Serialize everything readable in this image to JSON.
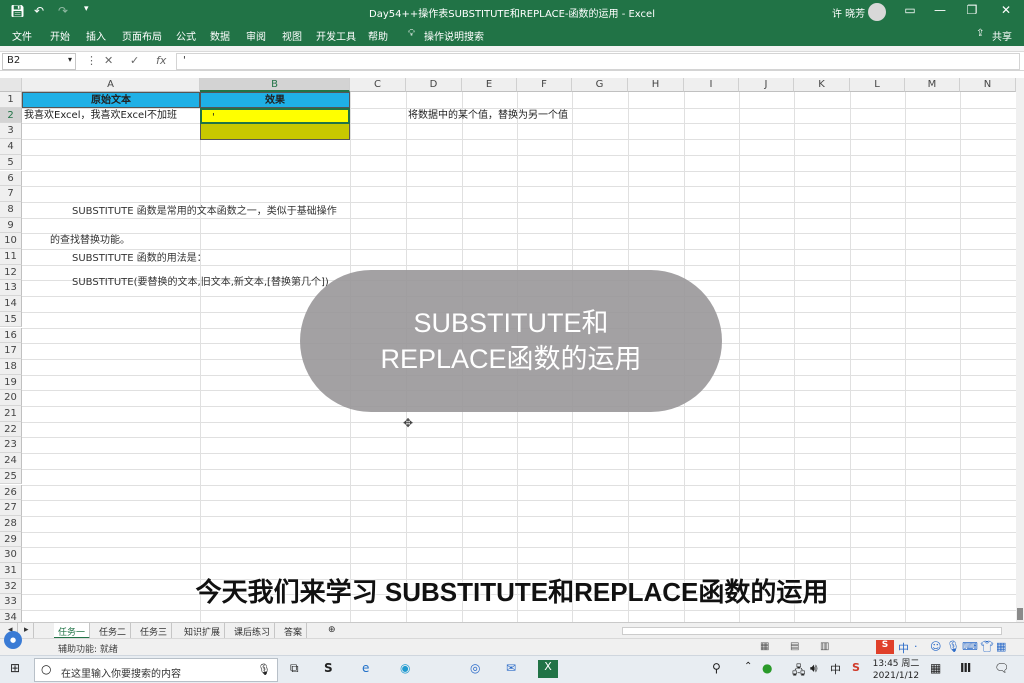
{
  "window": {
    "title": "Day54++操作表SUBSTITUTE和REPLACE-函数的运用 - Excel",
    "user": "许 晓芳",
    "qa_save_icon": "save-icon",
    "qa_undo_icon": "undo-icon",
    "qa_redo_icon": "redo-icon"
  },
  "menu": {
    "items": [
      "文件",
      "开始",
      "插入",
      "页面布局",
      "公式",
      "数据",
      "审阅",
      "视图",
      "开发工具",
      "帮助"
    ],
    "tell_me": "操作说明搜索",
    "share": "共享"
  },
  "formula_bar": {
    "name_box": "B2",
    "cancel": "✕",
    "confirm": "✓",
    "fx": "fx",
    "content": "'"
  },
  "columns": [
    "A",
    "B",
    "C",
    "D",
    "E",
    "F",
    "G",
    "H",
    "I",
    "J",
    "K",
    "L",
    "M",
    "N"
  ],
  "rows": [
    "1",
    "2",
    "3",
    "4",
    "5",
    "6",
    "7",
    "8",
    "9",
    "10",
    "11",
    "12",
    "13",
    "14",
    "15",
    "16",
    "17",
    "18",
    "19",
    "20",
    "21",
    "22",
    "23",
    "24",
    "25",
    "26",
    "27",
    "28",
    "29",
    "30",
    "31",
    "32",
    "33",
    "34"
  ],
  "cells": {
    "A1": "原始文本",
    "B1": "效果",
    "A2": "我喜欢Excel，我喜欢Excel不加班",
    "B2": "'",
    "D2": "将数据中的某个值，替换为另一个值",
    "A8": "SUBSTITUTE 函数是常用的文本函数之一，类似于基础操作",
    "A10": "的查找替换功能。",
    "A11": "SUBSTITUTE 函数的用法是：",
    "A13": "SUBSTITUTE(要替换的文本,旧文本,新文本,[替换第几个])"
  },
  "colors": {
    "excel_green": "#217346",
    "header_blue": "#1fb0e6",
    "cell_yellow": "#ffff00",
    "cell_olive": "#c8c800"
  },
  "sheet_tabs": [
    "任务一",
    "任务二",
    "任务三",
    "知识扩展",
    "课后练习",
    "答案"
  ],
  "active_tab": "任务一",
  "status": {
    "accessibility": "辅助功能: 就绪"
  },
  "overlay": {
    "line1": "SUBSTITUTE和",
    "line2": "REPLACE函数的运用"
  },
  "subtitle": "今天我们来学习 SUBSTITUTE和REPLACE函数的运用",
  "taskbar": {
    "search_placeholder": "在这里输入你要搜索的内容",
    "time": "13:45 周二",
    "date": "2021/1/12",
    "ime": "中"
  }
}
